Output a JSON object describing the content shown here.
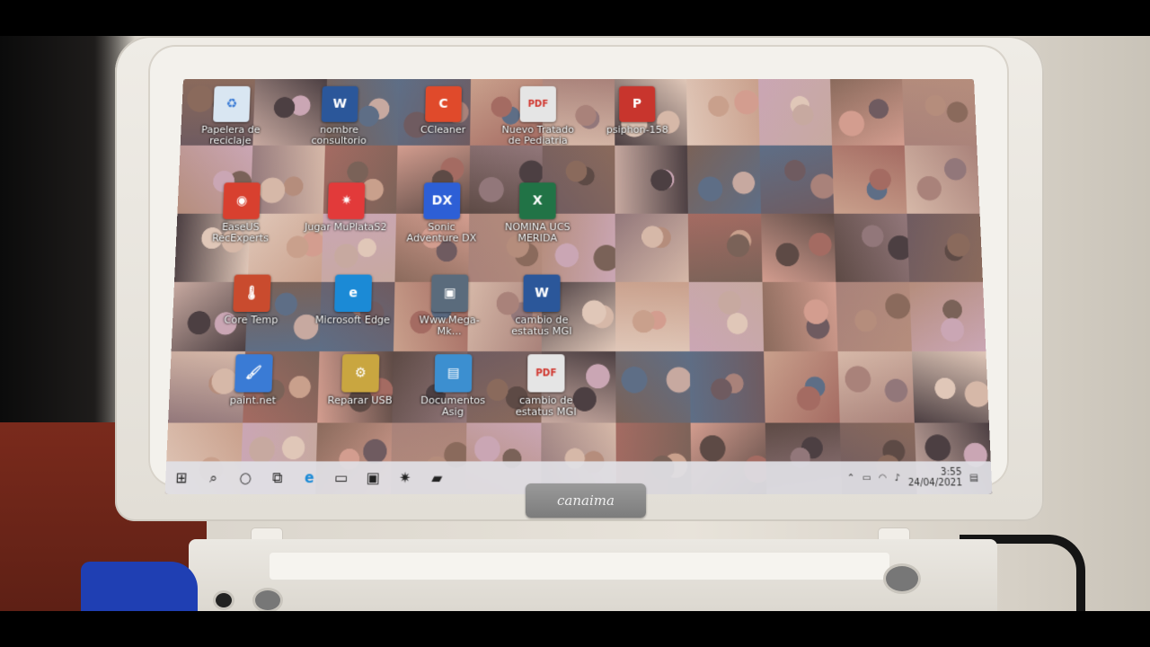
{
  "desktop": {
    "icons": [
      {
        "label": "Papelera de reciclaje",
        "icon": "recycle-bin-icon",
        "glyph": "♻",
        "color": "#d9e6f2"
      },
      {
        "label": "nombre consultorio",
        "icon": "word-document-icon",
        "glyph": "W",
        "color": "#2b579a"
      },
      {
        "label": "CCleaner",
        "icon": "ccleaner-icon",
        "glyph": "C",
        "color": "#e04a2b"
      },
      {
        "label": "Nuevo Tratado de Pediatria",
        "icon": "pdf-icon",
        "glyph": "PDF",
        "color": "#e5e5e5"
      },
      {
        "label": "psiphon-158",
        "icon": "psiphon-icon",
        "glyph": "P",
        "color": "#c8352d"
      },
      {
        "label": "EaseUS RecExperts",
        "icon": "easeus-recexperts-icon",
        "glyph": "◉",
        "color": "#d8402f"
      },
      {
        "label": "Jugar MuPlataS2",
        "icon": "game-shortcut-icon",
        "glyph": "✷",
        "color": "#e23a3a"
      },
      {
        "label": "Sonic Adventure DX",
        "icon": "sonic-adventure-icon",
        "glyph": "DX",
        "color": "#2d5fd6"
      },
      {
        "label": "NOMINA UCS MERIDA",
        "icon": "excel-document-icon",
        "glyph": "X",
        "color": "#217346"
      },
      {
        "label": "Core Temp",
        "icon": "thermometer-icon",
        "glyph": "🌡",
        "color": "#c94b2e"
      },
      {
        "label": "Microsoft Edge",
        "icon": "edge-browser-icon",
        "glyph": "e",
        "color": "#1b8ad6"
      },
      {
        "label": "Www.Mega-Mk...",
        "icon": "shortcut-icon",
        "glyph": "▣",
        "color": "#5a6b7c"
      },
      {
        "label": "cambio de estatus MGI",
        "icon": "word-document-icon",
        "glyph": "W",
        "color": "#2b579a"
      },
      {
        "label": "paint.net",
        "icon": "paint-net-icon",
        "glyph": "🖌",
        "color": "#3a7bd5"
      },
      {
        "label": "Reparar USB",
        "icon": "usb-repair-icon",
        "glyph": "⚙",
        "color": "#c9a640"
      },
      {
        "label": "Documentos Asig",
        "icon": "folder-shortcut-icon",
        "glyph": "▤",
        "color": "#3c8fd0"
      },
      {
        "label": "cambio de estatus MGI",
        "icon": "pdf-icon",
        "glyph": "PDF",
        "color": "#e5e5e5"
      }
    ]
  },
  "taskbar": {
    "items": [
      {
        "icon": "windows-start-icon",
        "glyph": "⊞"
      },
      {
        "icon": "search-icon",
        "glyph": "⌕"
      },
      {
        "icon": "cortana-icon",
        "glyph": "○"
      },
      {
        "icon": "task-view-icon",
        "glyph": "⧉"
      },
      {
        "icon": "edge-browser-icon",
        "glyph": "e"
      },
      {
        "icon": "file-explorer-icon",
        "glyph": "▭"
      },
      {
        "icon": "store-icon",
        "glyph": "▣"
      },
      {
        "icon": "app-icon",
        "glyph": "✷"
      },
      {
        "icon": "app-icon",
        "glyph": "▰"
      }
    ],
    "clock": {
      "time": "3:55",
      "date": "24/04/2021"
    }
  },
  "colors": {
    "taskbar": "#e1e1e6",
    "laptop_shell": "#efece6"
  }
}
